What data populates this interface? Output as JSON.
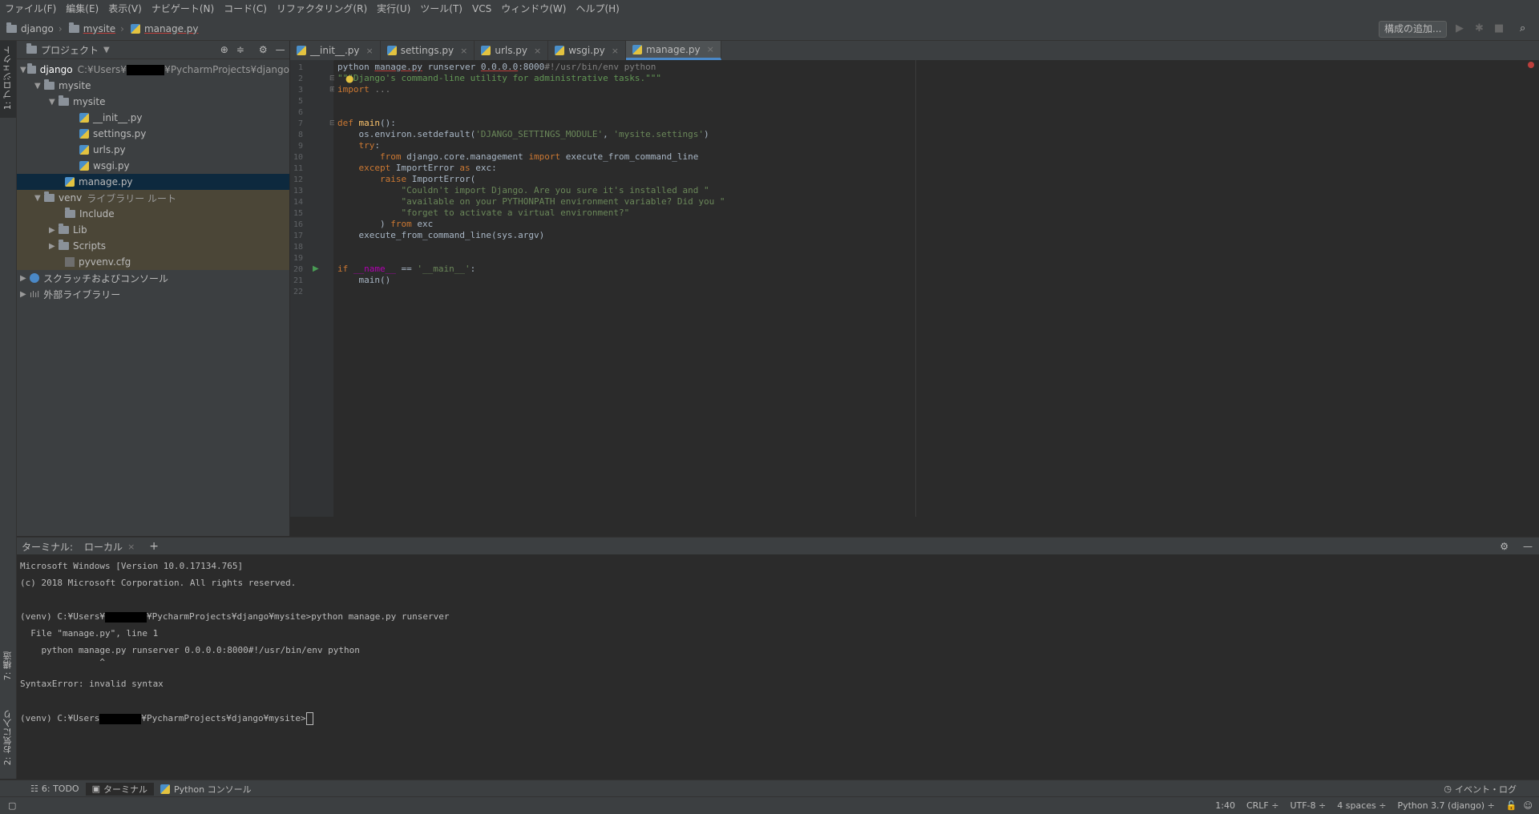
{
  "menu": [
    "ファイル(F)",
    "編集(E)",
    "表示(V)",
    "ナビゲート(N)",
    "コード(C)",
    "リファクタリング(R)",
    "実行(U)",
    "ツール(T)",
    "VCS",
    "ウィンドウ(W)",
    "ヘルプ(H)"
  ],
  "breadcrumb": {
    "root": "django",
    "folder": "mysite",
    "file": "manage.py"
  },
  "toolbar": {
    "config_label": "構成の追加..."
  },
  "left_tools": {
    "project_tab": "1: プロジェクト",
    "structure_tab": "7: 構造",
    "favorites_tab": "2: お気に入り"
  },
  "project_panel": {
    "title": "プロジェクト"
  },
  "tree": [
    {
      "label": "django",
      "extra": "C:¥Users¥",
      "path_tail": "¥PycharmProjects¥django"
    },
    {
      "label": "mysite"
    },
    {
      "label": "mysite"
    },
    {
      "label": "__init__.py"
    },
    {
      "label": "settings.py"
    },
    {
      "label": "urls.py"
    },
    {
      "label": "wsgi.py"
    },
    {
      "label": "manage.py"
    },
    {
      "label": "venv",
      "extra": "ライブラリー ルート"
    },
    {
      "label": "Include"
    },
    {
      "label": "Lib"
    },
    {
      "label": "Scripts"
    },
    {
      "label": "pyvenv.cfg"
    },
    {
      "label": "スクラッチおよびコンソール"
    },
    {
      "label": "外部ライブラリー"
    }
  ],
  "tabs": [
    "__init__.py",
    "settings.py",
    "urls.py",
    "wsgi.py",
    "manage.py"
  ],
  "active_tab": "manage.py",
  "line_numbers": [
    "1",
    "2",
    "3",
    "5",
    "6",
    "7",
    "8",
    "9",
    "10",
    "11",
    "12",
    "13",
    "14",
    "15",
    "16",
    "17",
    "18",
    "19",
    "20",
    "21",
    "22"
  ],
  "terminal": {
    "tab_label": "ターミナル:",
    "session": "ローカル",
    "lines": [
      "Microsoft Windows [Version 10.0.17134.765]",
      "(c) 2018 Microsoft Corporation. All rights reserved.",
      "",
      "(venv) C:¥Users¥",
      "  File \"manage.py\", line 1",
      "    python manage.py runserver 0.0.0.0:8000#!/usr/bin/env python",
      "               ^",
      "SyntaxError: invalid syntax",
      "",
      "(venv) C:¥Users"
    ],
    "line3_tail": "¥PycharmProjects¥django¥mysite>python manage.py runserver",
    "line9_tail": "¥PycharmProjects¥django¥mysite>"
  },
  "bottom_tabs": {
    "todo": "6: TODO",
    "terminal": "ターミナル",
    "python_console": "Python コンソール",
    "event_log": "イベント・ログ"
  },
  "status": {
    "position": "1:40",
    "line_sep": "CRLF ÷",
    "encoding": "UTF-8 ÷",
    "indent": "4 spaces ÷",
    "interpreter": "Python 3.7 (django) ÷"
  },
  "colors": {
    "accent": "#4a88c7",
    "keyword": "#cc7832",
    "string": "#6a8759",
    "function": "#ffc66d"
  }
}
